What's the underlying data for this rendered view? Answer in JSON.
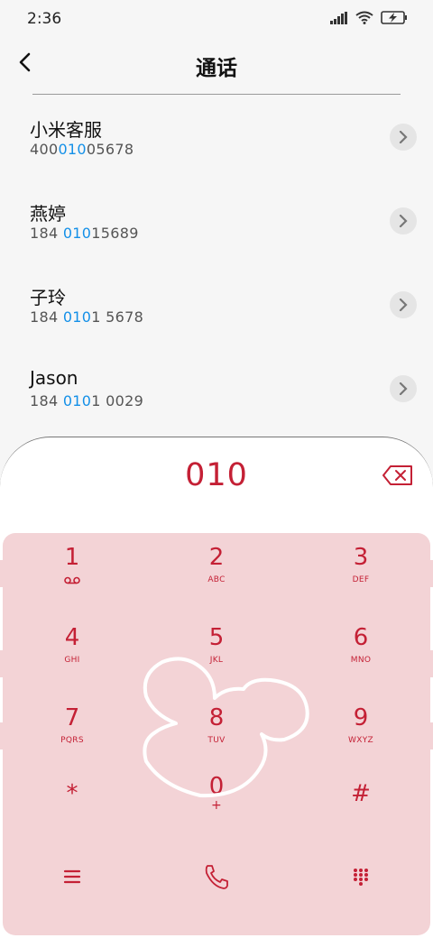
{
  "status_bar": {
    "time": "2:36",
    "icons": [
      "signal-icon",
      "wifi-icon",
      "battery-charging-icon"
    ]
  },
  "header": {
    "back_icon": "chevron-left-icon",
    "title": "通话"
  },
  "contacts": [
    {
      "name": "小米客服",
      "number_parts": [
        {
          "t": "400",
          "hl": false
        },
        {
          "t": "010",
          "hl": true
        },
        {
          "t": "05678",
          "hl": false
        }
      ]
    },
    {
      "name": "燕婷",
      "number_parts": [
        {
          "t": "184 ",
          "hl": false
        },
        {
          "t": "010",
          "hl": true
        },
        {
          "t": "15689",
          "hl": false
        }
      ]
    },
    {
      "name": "子玲",
      "number_parts": [
        {
          "t": "184 ",
          "hl": false
        },
        {
          "t": "010",
          "hl": true
        },
        {
          "t": "1 5678",
          "hl": false
        }
      ]
    },
    {
      "name": "Jason",
      "number_parts": [
        {
          "t": "184 ",
          "hl": false
        },
        {
          "t": "010",
          "hl": true
        },
        {
          "t": "1 0029",
          "hl": false
        }
      ]
    }
  ],
  "dialer": {
    "dialed_number": "010",
    "backspace_icon": "backspace-icon",
    "accent_color": "#c42035",
    "pad_color": "#f3d3d6",
    "keys": [
      {
        "digit": "1",
        "letters": "",
        "voicemail": true
      },
      {
        "digit": "2",
        "letters": "ABC"
      },
      {
        "digit": "3",
        "letters": "DEF"
      },
      {
        "digit": "4",
        "letters": "GHI"
      },
      {
        "digit": "5",
        "letters": "JKL"
      },
      {
        "digit": "6",
        "letters": "MNO"
      },
      {
        "digit": "7",
        "letters": "PQRS"
      },
      {
        "digit": "8",
        "letters": "TUV"
      },
      {
        "digit": "9",
        "letters": "WXYZ"
      },
      {
        "digit": "*",
        "letters": ""
      },
      {
        "digit": "0",
        "letters": "+"
      },
      {
        "digit": "#",
        "letters": ""
      }
    ],
    "bottom_buttons": [
      "menu-icon",
      "call-icon",
      "keypad-icon"
    ]
  }
}
